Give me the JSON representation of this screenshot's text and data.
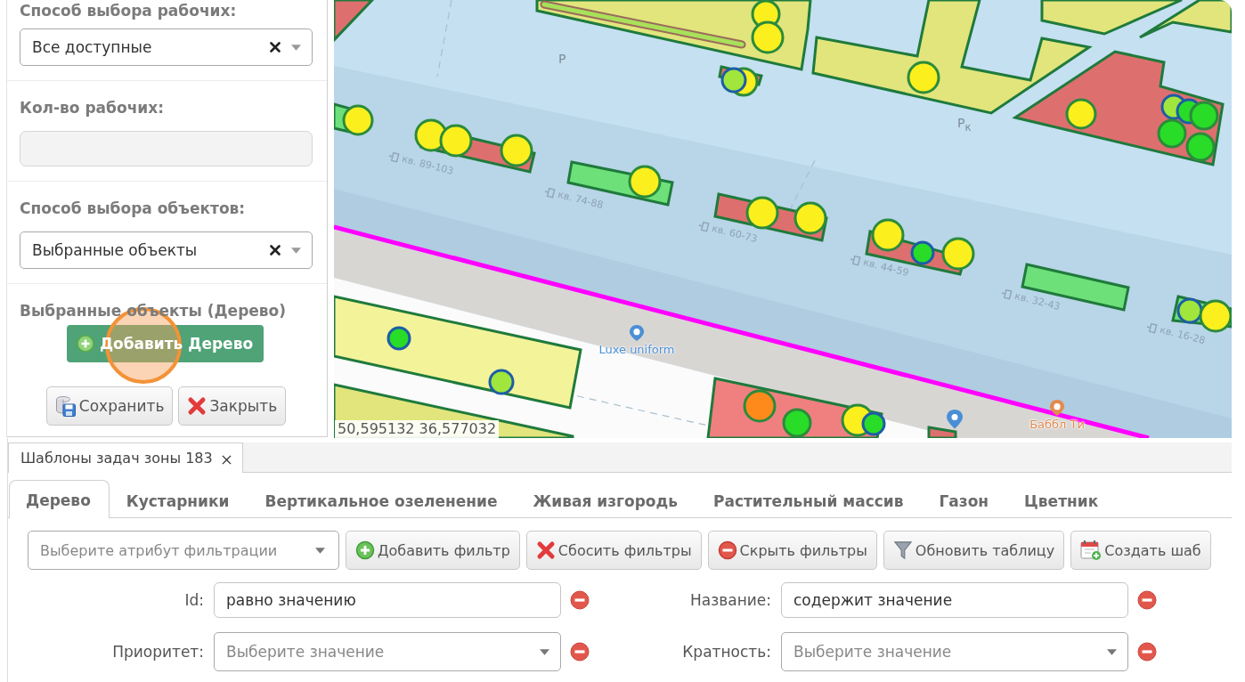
{
  "side_panel": {
    "sections": [
      {
        "kind": "select",
        "label": "Способ выбора рабочих:",
        "value": "Все доступные"
      },
      {
        "kind": "input",
        "label": "Кол-во рабочих:",
        "disabled": true
      },
      {
        "kind": "select",
        "label": "Способ выбора объектов:",
        "value": "Выбранные объекты"
      },
      {
        "kind": "objects",
        "label": "Выбранные объекты (Дерево)",
        "button": {
          "label": "Добавить Дерево",
          "click_marker": true
        }
      }
    ],
    "buttons": [
      {
        "kind": "save",
        "label": "Сохранить"
      },
      {
        "kind": "close",
        "label": "Закрыть"
      }
    ]
  },
  "map": {
    "labels": [
      {
        "kind": "road",
        "text": "Р"
      },
      {
        "kind": "road",
        "text": "Р$_{к}$"
      },
      {
        "kind": "entrance",
        "text": "кв. 89-103"
      },
      {
        "kind": "entrance",
        "text": "кв. 74-88"
      },
      {
        "kind": "entrance",
        "text": "кв. 60-73"
      },
      {
        "kind": "entrance",
        "text": "кв. 44-59"
      },
      {
        "kind": "entrance",
        "text": "кв. 32-43"
      },
      {
        "kind": "entrance",
        "text": "кв. 16-28"
      },
      {
        "kind": "poi",
        "text": "Luxe uniform",
        "color": "#4a8fd6"
      },
      {
        "kind": "poi",
        "text": "Баббл Ти",
        "color": "#e38b4f"
      }
    ],
    "coordinates": "50,595132 36,577032"
  },
  "document_tabs": [
    {
      "label": "Шаблоны задач зоны 183",
      "selected": true,
      "closable": true
    }
  ],
  "category_tabs": [
    {
      "label": "Дерево",
      "selected": true
    },
    {
      "label": "Кустарники",
      "selected": false
    },
    {
      "label": "Вертикальное озеленение",
      "selected": false
    },
    {
      "label": "Живая изгородь",
      "selected": false
    },
    {
      "label": "Растительный массив",
      "selected": false
    },
    {
      "label": "Газон",
      "selected": false
    },
    {
      "label": "Цветник",
      "selected": false
    }
  ],
  "toolbar": {
    "filter_select": {
      "placeholder": "Выберите атрибут фильтрации"
    },
    "buttons": [
      {
        "kind": "add",
        "label": "Добавить фильтр"
      },
      {
        "kind": "reset",
        "label": "Сбосить фильтры"
      },
      {
        "kind": "hide",
        "label": "Скрыть фильтры"
      },
      {
        "kind": "refresh",
        "label": "Обновить таблицу"
      },
      {
        "kind": "create",
        "label": "Создать шаб"
      }
    ]
  },
  "filters": [
    {
      "kind": "text",
      "label": "Id:",
      "value": "равно значению"
    },
    {
      "kind": "text",
      "label": "Название:",
      "value": "содержит значение"
    },
    {
      "kind": "select",
      "label": "Приоритет:",
      "placeholder": "Выберите значение"
    },
    {
      "kind": "select",
      "label": "Кратность:",
      "placeholder": "Выберите значение"
    }
  ]
}
